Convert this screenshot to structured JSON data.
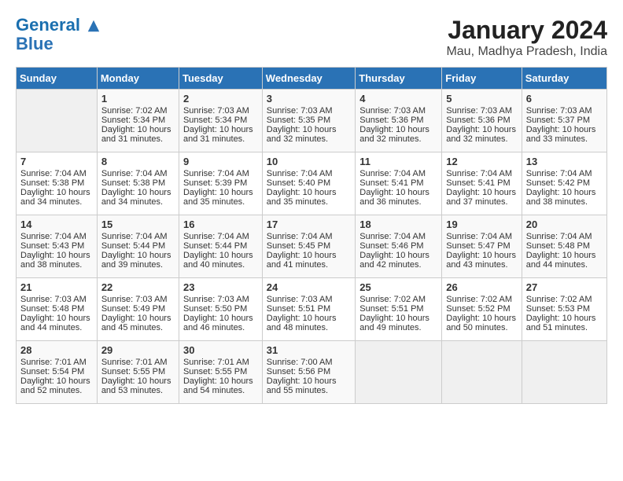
{
  "header": {
    "logo_line1": "General",
    "logo_line2": "Blue",
    "title": "January 2024",
    "subtitle": "Mau, Madhya Pradesh, India"
  },
  "days_of_week": [
    "Sunday",
    "Monday",
    "Tuesday",
    "Wednesday",
    "Thursday",
    "Friday",
    "Saturday"
  ],
  "weeks": [
    [
      {
        "num": "",
        "empty": true
      },
      {
        "num": "1",
        "sunrise": "7:02 AM",
        "sunset": "5:34 PM",
        "daylight": "10 hours and 31 minutes."
      },
      {
        "num": "2",
        "sunrise": "7:03 AM",
        "sunset": "5:34 PM",
        "daylight": "10 hours and 31 minutes."
      },
      {
        "num": "3",
        "sunrise": "7:03 AM",
        "sunset": "5:35 PM",
        "daylight": "10 hours and 32 minutes."
      },
      {
        "num": "4",
        "sunrise": "7:03 AM",
        "sunset": "5:36 PM",
        "daylight": "10 hours and 32 minutes."
      },
      {
        "num": "5",
        "sunrise": "7:03 AM",
        "sunset": "5:36 PM",
        "daylight": "10 hours and 32 minutes."
      },
      {
        "num": "6",
        "sunrise": "7:03 AM",
        "sunset": "5:37 PM",
        "daylight": "10 hours and 33 minutes."
      }
    ],
    [
      {
        "num": "7",
        "sunrise": "7:04 AM",
        "sunset": "5:38 PM",
        "daylight": "10 hours and 34 minutes."
      },
      {
        "num": "8",
        "sunrise": "7:04 AM",
        "sunset": "5:38 PM",
        "daylight": "10 hours and 34 minutes."
      },
      {
        "num": "9",
        "sunrise": "7:04 AM",
        "sunset": "5:39 PM",
        "daylight": "10 hours and 35 minutes."
      },
      {
        "num": "10",
        "sunrise": "7:04 AM",
        "sunset": "5:40 PM",
        "daylight": "10 hours and 35 minutes."
      },
      {
        "num": "11",
        "sunrise": "7:04 AM",
        "sunset": "5:41 PM",
        "daylight": "10 hours and 36 minutes."
      },
      {
        "num": "12",
        "sunrise": "7:04 AM",
        "sunset": "5:41 PM",
        "daylight": "10 hours and 37 minutes."
      },
      {
        "num": "13",
        "sunrise": "7:04 AM",
        "sunset": "5:42 PM",
        "daylight": "10 hours and 38 minutes."
      }
    ],
    [
      {
        "num": "14",
        "sunrise": "7:04 AM",
        "sunset": "5:43 PM",
        "daylight": "10 hours and 38 minutes."
      },
      {
        "num": "15",
        "sunrise": "7:04 AM",
        "sunset": "5:44 PM",
        "daylight": "10 hours and 39 minutes."
      },
      {
        "num": "16",
        "sunrise": "7:04 AM",
        "sunset": "5:44 PM",
        "daylight": "10 hours and 40 minutes."
      },
      {
        "num": "17",
        "sunrise": "7:04 AM",
        "sunset": "5:45 PM",
        "daylight": "10 hours and 41 minutes."
      },
      {
        "num": "18",
        "sunrise": "7:04 AM",
        "sunset": "5:46 PM",
        "daylight": "10 hours and 42 minutes."
      },
      {
        "num": "19",
        "sunrise": "7:04 AM",
        "sunset": "5:47 PM",
        "daylight": "10 hours and 43 minutes."
      },
      {
        "num": "20",
        "sunrise": "7:04 AM",
        "sunset": "5:48 PM",
        "daylight": "10 hours and 44 minutes."
      }
    ],
    [
      {
        "num": "21",
        "sunrise": "7:03 AM",
        "sunset": "5:48 PM",
        "daylight": "10 hours and 44 minutes."
      },
      {
        "num": "22",
        "sunrise": "7:03 AM",
        "sunset": "5:49 PM",
        "daylight": "10 hours and 45 minutes."
      },
      {
        "num": "23",
        "sunrise": "7:03 AM",
        "sunset": "5:50 PM",
        "daylight": "10 hours and 46 minutes."
      },
      {
        "num": "24",
        "sunrise": "7:03 AM",
        "sunset": "5:51 PM",
        "daylight": "10 hours and 48 minutes."
      },
      {
        "num": "25",
        "sunrise": "7:02 AM",
        "sunset": "5:51 PM",
        "daylight": "10 hours and 49 minutes."
      },
      {
        "num": "26",
        "sunrise": "7:02 AM",
        "sunset": "5:52 PM",
        "daylight": "10 hours and 50 minutes."
      },
      {
        "num": "27",
        "sunrise": "7:02 AM",
        "sunset": "5:53 PM",
        "daylight": "10 hours and 51 minutes."
      }
    ],
    [
      {
        "num": "28",
        "sunrise": "7:01 AM",
        "sunset": "5:54 PM",
        "daylight": "10 hours and 52 minutes."
      },
      {
        "num": "29",
        "sunrise": "7:01 AM",
        "sunset": "5:55 PM",
        "daylight": "10 hours and 53 minutes."
      },
      {
        "num": "30",
        "sunrise": "7:01 AM",
        "sunset": "5:55 PM",
        "daylight": "10 hours and 54 minutes."
      },
      {
        "num": "31",
        "sunrise": "7:00 AM",
        "sunset": "5:56 PM",
        "daylight": "10 hours and 55 minutes."
      },
      {
        "num": "",
        "empty": true
      },
      {
        "num": "",
        "empty": true
      },
      {
        "num": "",
        "empty": true
      }
    ]
  ]
}
